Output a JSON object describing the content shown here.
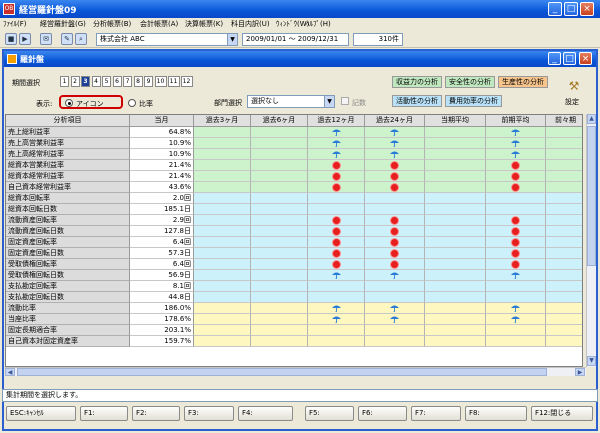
{
  "app": {
    "title": "経営羅針盤09"
  },
  "menu": [
    "ﾌｧｲﾙ(F)",
    "経営羅針盤(G)",
    "分析帳票(B)",
    "会計帳票(A)",
    "決算帳票(K)",
    "科目内訳(U)",
    "ｳｨﾝﾄﾞｳ(W)",
    "ﾍﾙﾌﾟ(H)"
  ],
  "toolbar": {
    "company": "株式会社 ABC",
    "period_range": "2009/01/01 ～ 2009/12/31",
    "record_count": "310件"
  },
  "window": {
    "title": "羅針盤"
  },
  "period": {
    "label": "期間選択",
    "options": [
      "1",
      "2",
      "3",
      "4",
      "5",
      "6",
      "7",
      "8",
      "9",
      "10",
      "11",
      "12"
    ],
    "selected": "3"
  },
  "display": {
    "label": "表示:",
    "icon_option": "アイコン",
    "ratio_option": "比率",
    "selected": "アイコン"
  },
  "department": {
    "label": "部門選択",
    "value": "選択なし",
    "checkbox_label": "記数"
  },
  "analysis_buttons": {
    "profitability": "収益力の分析",
    "safety": "安全性の分析",
    "productivity": "生産性の分析",
    "activity": "活動性の分析",
    "cost_efficiency": "費用効率の分析"
  },
  "settings": {
    "label": "設定"
  },
  "table": {
    "headers": [
      "分析項目",
      "当月",
      "過去3ヶ月",
      "過去6ヶ月",
      "過去12ヶ月",
      "過去24ヶ月",
      "当期平均",
      "前期平均",
      "前々期"
    ],
    "rows": [
      {
        "name": "売上総利益率",
        "value": "64.8%",
        "group": "a",
        "icons": [
          "",
          "",
          "umbrella",
          "umbrella",
          "",
          "umbrella",
          ""
        ]
      },
      {
        "name": "売上高営業利益率",
        "value": "10.9%",
        "group": "a",
        "icons": [
          "",
          "",
          "umbrella",
          "umbrella",
          "",
          "umbrella",
          ""
        ]
      },
      {
        "name": "売上高経常利益率",
        "value": "10.9%",
        "group": "a",
        "icons": [
          "",
          "",
          "umbrella",
          "umbrella",
          "",
          "umbrella",
          ""
        ]
      },
      {
        "name": "総資本営業利益率",
        "value": "21.4%",
        "group": "a",
        "icons": [
          "",
          "",
          "sun",
          "sun",
          "",
          "sun",
          ""
        ]
      },
      {
        "name": "総資本経常利益率",
        "value": "21.4%",
        "group": "a",
        "icons": [
          "",
          "",
          "sun",
          "sun",
          "",
          "sun",
          ""
        ]
      },
      {
        "name": "自己資本経常利益率",
        "value": "43.6%",
        "group": "a",
        "icons": [
          "",
          "",
          "sun",
          "sun",
          "",
          "sun",
          ""
        ]
      },
      {
        "name": "総資本回転率",
        "value": "2.0回",
        "group": "b",
        "icons": [
          "",
          "",
          "",
          "",
          "",
          "",
          ""
        ]
      },
      {
        "name": "総資本回転日数",
        "value": "185.1日",
        "group": "b",
        "icons": [
          "",
          "",
          "",
          "",
          "",
          "",
          ""
        ]
      },
      {
        "name": "流動資産回転率",
        "value": "2.9回",
        "group": "b",
        "icons": [
          "",
          "",
          "sun",
          "sun",
          "",
          "sun",
          ""
        ]
      },
      {
        "name": "流動資産回転日数",
        "value": "127.8日",
        "group": "b",
        "icons": [
          "",
          "",
          "sun",
          "sun",
          "",
          "sun",
          ""
        ]
      },
      {
        "name": "固定資産回転率",
        "value": "6.4回",
        "group": "b",
        "icons": [
          "",
          "",
          "sun",
          "sun",
          "",
          "sun",
          ""
        ]
      },
      {
        "name": "固定資産回転日数",
        "value": "57.3日",
        "group": "b",
        "icons": [
          "",
          "",
          "sun",
          "sun",
          "",
          "sun",
          ""
        ]
      },
      {
        "name": "受取債権回転率",
        "value": "6.4回",
        "group": "b",
        "icons": [
          "",
          "",
          "sun",
          "sun",
          "",
          "sun",
          ""
        ]
      },
      {
        "name": "受取債権回転日数",
        "value": "56.9日",
        "group": "b",
        "icons": [
          "",
          "",
          "umbrella",
          "umbrella",
          "",
          "umbrella",
          ""
        ]
      },
      {
        "name": "支払勘定回転率",
        "value": "8.1回",
        "group": "b",
        "icons": [
          "",
          "",
          "",
          "",
          "",
          "",
          ""
        ]
      },
      {
        "name": "支払勘定回転日数",
        "value": "44.8日",
        "group": "b",
        "icons": [
          "",
          "",
          "",
          "",
          "",
          "",
          ""
        ]
      },
      {
        "name": "流動比率",
        "value": "186.0%",
        "group": "c",
        "icons": [
          "",
          "",
          "umbrella",
          "umbrella",
          "",
          "umbrella",
          ""
        ]
      },
      {
        "name": "当座比率",
        "value": "178.6%",
        "group": "c",
        "icons": [
          "",
          "",
          "umbrella",
          "umbrella",
          "",
          "umbrella",
          ""
        ]
      },
      {
        "name": "固定長期適合率",
        "value": "203.1%",
        "group": "c",
        "icons": [
          "",
          "",
          "",
          "",
          "",
          "",
          ""
        ]
      },
      {
        "name": "自己資本対固定資産率",
        "value": "159.7%",
        "group": "c",
        "icons": [
          "",
          "",
          "",
          "",
          "",
          "",
          ""
        ]
      }
    ]
  },
  "colors": {
    "profit": "#cdf3cd",
    "activity": "#ccf1fb",
    "safety": "#fff7c0",
    "sun": "#e61f1f",
    "umbrella": "#2a7bd6"
  },
  "status": "集計期間を選択します。",
  "fkeys": [
    "ESC:ｷｬﾝｾﾙ",
    "F1:",
    "F2:",
    "F3:",
    "F4:",
    "F5:",
    "F6:",
    "F7:",
    "F8:",
    "F12:閉じる"
  ]
}
